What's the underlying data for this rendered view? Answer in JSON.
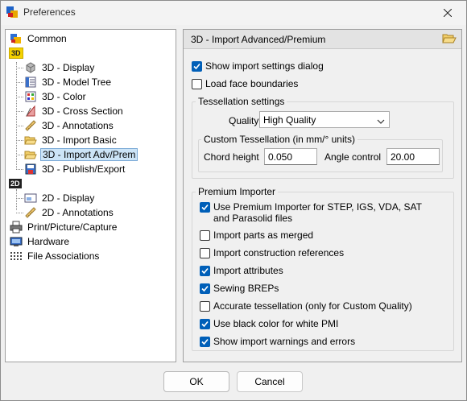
{
  "window": {
    "title": "Preferences"
  },
  "tree": {
    "common": "Common",
    "tag_3d": "3D",
    "items_3d": [
      "3D - Display",
      "3D - Model Tree",
      "3D - Color",
      "3D - Cross Section",
      "3D - Annotations",
      "3D - Import Basic",
      "3D - Import Adv/Prem",
      "3D - Publish/Export"
    ],
    "tag_2d": "2D",
    "items_2d": [
      "2D - Display",
      "2D - Annotations"
    ],
    "print": "Print/Picture/Capture",
    "hardware": "Hardware",
    "file_assoc": "File Associations",
    "selected": "3D - Import Adv/Prem"
  },
  "panel": {
    "title": "3D - Import Advanced/Premium",
    "show_import_dialog": {
      "label": "Show import settings dialog",
      "checked": true
    },
    "load_face_boundaries": {
      "label": "Load face boundaries",
      "checked": false
    },
    "tessellation": {
      "title": "Tessellation settings",
      "quality_label": "Quality",
      "quality_value": "High Quality",
      "custom": {
        "title": "Custom Tessellation (in mm/° units)",
        "chord_label": "Chord height",
        "chord_value": "0.050",
        "angle_label": "Angle control",
        "angle_value": "20.00"
      }
    },
    "premium": {
      "title": "Premium Importer",
      "options": [
        {
          "label_line1": "Use Premium Importer for STEP, IGS, VDA, SAT",
          "label_line2": "and Parasolid files",
          "checked": true
        },
        {
          "label": "Import parts as merged",
          "checked": false
        },
        {
          "label": "Import construction references",
          "checked": false
        },
        {
          "label": "Import attributes",
          "checked": true
        },
        {
          "label": "Sewing BREPs",
          "checked": true
        },
        {
          "label": "Accurate tessellation (only for Custom Quality)",
          "checked": false
        },
        {
          "label": "Use black color for white PMI",
          "checked": true
        },
        {
          "label": "Show import warnings and errors",
          "checked": true
        }
      ]
    }
  },
  "buttons": {
    "ok": "OK",
    "cancel": "Cancel"
  },
  "colors": {
    "accent": "#005fb8",
    "selection": "#cce4f7",
    "tag3d": "#f5d200"
  }
}
